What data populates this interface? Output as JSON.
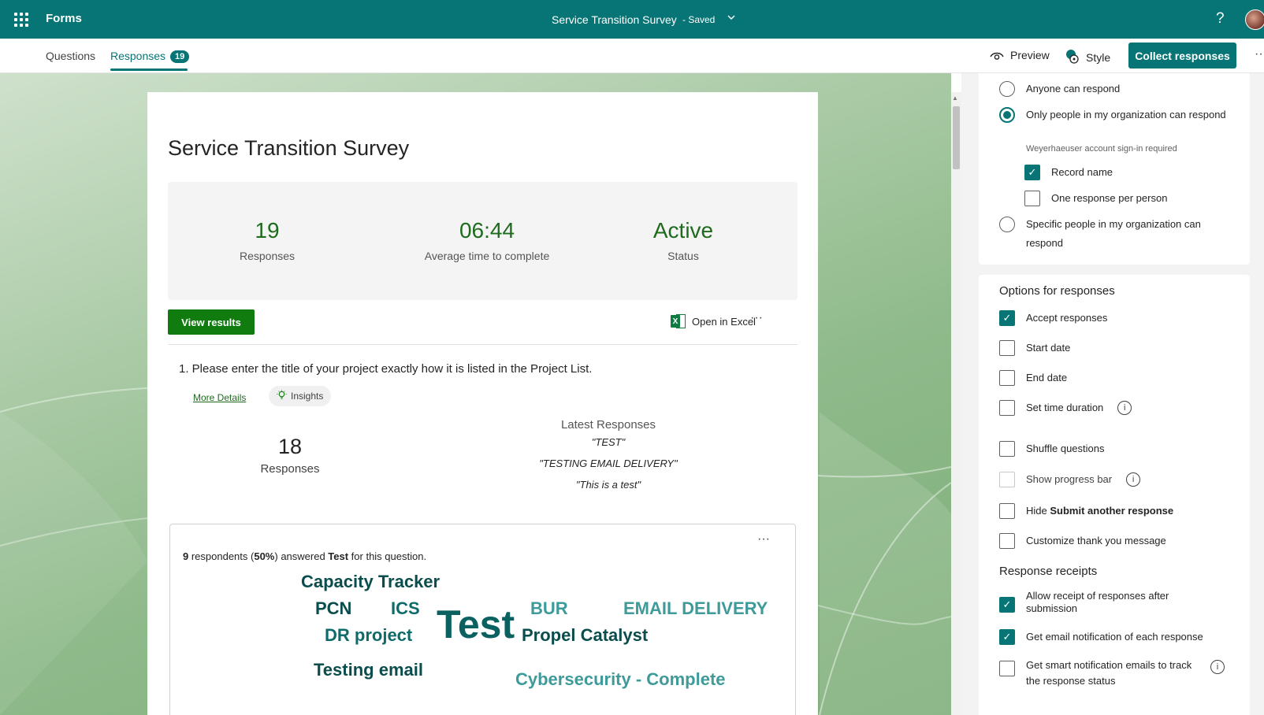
{
  "topbar": {
    "app_name": "Forms",
    "doc_title": "Service Transition Survey",
    "saved": "- Saved",
    "help": "?"
  },
  "tabs": {
    "questions": "Questions",
    "responses": "Responses",
    "responses_count": "19"
  },
  "toolbar": {
    "preview": "Preview",
    "style": "Style",
    "collect": "Collect responses"
  },
  "survey": {
    "title": "Service Transition Survey",
    "stats": [
      {
        "value": "19",
        "label": "Responses"
      },
      {
        "value": "06:44",
        "label": "Average time to complete"
      },
      {
        "value": "Active",
        "label": "Status"
      }
    ],
    "view_results": "View results",
    "open_excel": "Open in Excel"
  },
  "question1": {
    "text": "1.  Please enter the title of your project exactly how it is listed in the Project List.",
    "more_details": "More Details",
    "insights": "Insights",
    "responses_value": "18",
    "responses_label": "Responses",
    "latest_title": "Latest Responses",
    "latest": [
      "\"TEST\"",
      "\"TESTING EMAIL DELIVERY\"",
      "\"This is a test\""
    ],
    "summary_count": "9",
    "summary_mid": " respondents (",
    "summary_pct": "50%",
    "summary_mid2": ") answered ",
    "summary_word": "Test",
    "summary_end": " for this question."
  },
  "word_cloud": [
    {
      "text": "Capacity Tracker",
      "color": "#0b4d4d"
    },
    {
      "text": "PCN",
      "color": "#0b4d4d"
    },
    {
      "text": "ICS",
      "color": "#0f6b6b"
    },
    {
      "text": "Test",
      "color": "#0b6060"
    },
    {
      "text": "BUR",
      "color": "#3f9a9a"
    },
    {
      "text": "EMAIL DELIVERY",
      "color": "#3f9a9a"
    },
    {
      "text": "DR project",
      "color": "#0f6b6b"
    },
    {
      "text": "Propel Catalyst",
      "color": "#0b4d4d"
    },
    {
      "text": "Testing email",
      "color": "#0b4d4d"
    },
    {
      "text": "Cybersecurity - Complete",
      "color": "#3f9a9a"
    }
  ],
  "panel": {
    "who": [
      {
        "label": "Anyone can respond",
        "selected": false
      },
      {
        "label": "Only people in my organization can respond",
        "selected": true
      },
      {
        "label": "Specific people in my organization can respond",
        "selected": false
      }
    ],
    "sign_in_note": "Weyerhaeuser account sign-in required",
    "record_name": "Record name",
    "one_response": "One response per person",
    "options_title": "Options for responses",
    "accept": "Accept responses",
    "start_date": "Start date",
    "end_date": "End date",
    "time_duration": "Set time duration",
    "shuffle": "Shuffle questions",
    "progress_bar": "Show progress bar",
    "hide_prefix": "Hide ",
    "hide_bold": "Submit another response",
    "thank_you": "Customize thank you message",
    "receipts_title": "Response receipts",
    "allow_receipt": "Allow receipt of responses after submission",
    "email_notif": "Get email notification of each response",
    "smart_notif": "Get smart notification emails to track the response status"
  },
  "colors": {
    "brand": "#077575",
    "accent_green": "#107c10",
    "stat_green": "#1e6b1e"
  }
}
